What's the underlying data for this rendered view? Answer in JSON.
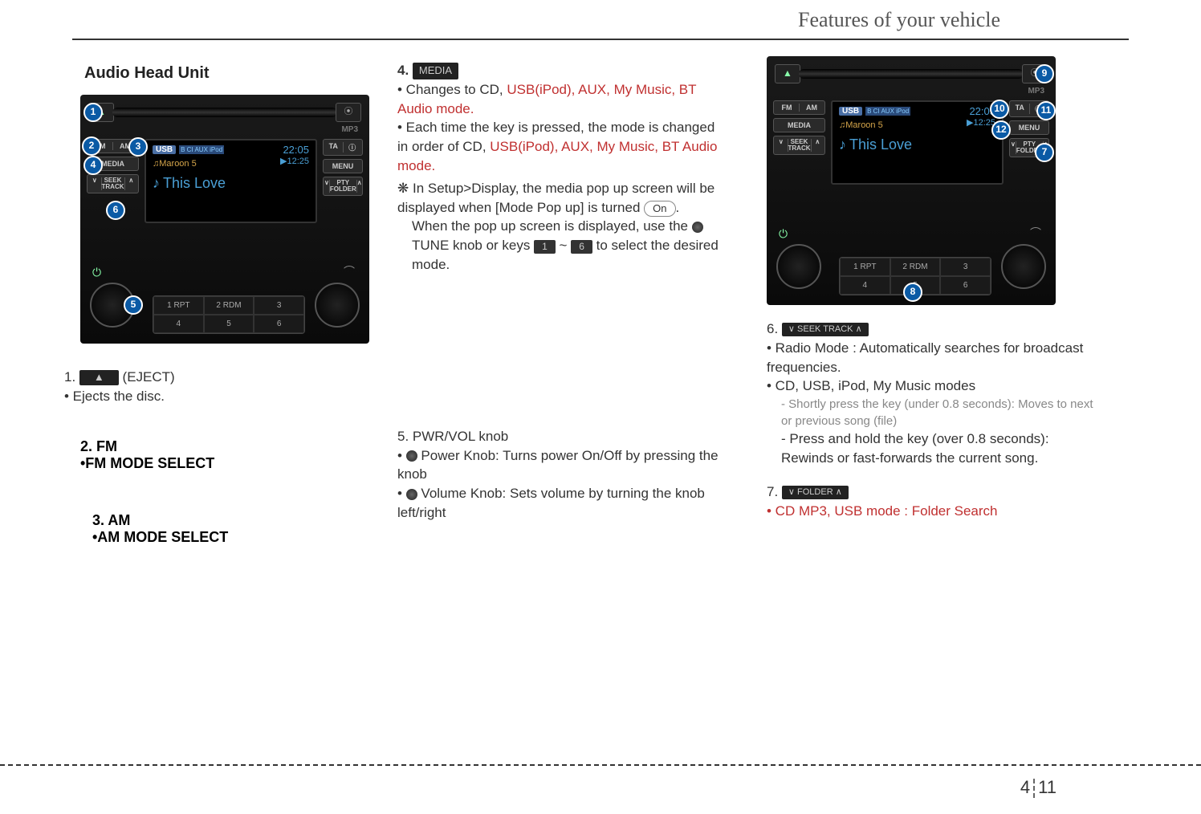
{
  "header": {
    "title": "Features of your vehicle"
  },
  "page": {
    "section": "4",
    "num": "11"
  },
  "heading": "Audio Head Unit",
  "display": {
    "source": "USB",
    "mode_icons": "B CI AUX iPod",
    "clock": "22:05",
    "artist_prefix": "♫",
    "artist": "Maroon 5",
    "play_time": "▶12:25",
    "song_prefix": "♪",
    "song": "This Love",
    "mp3": "MP3"
  },
  "buttons": {
    "eject": "▲",
    "cd": "⦿",
    "fm": "FM",
    "am": "AM",
    "media": "MEDIA",
    "seek_track_down": "∨",
    "seek_track": "SEEK\nTRACK",
    "seek_track_up": "∧",
    "ta": "TA",
    "info": "ⓘ",
    "menu": "MENU",
    "pty_folder_down": "∨",
    "pty_folder": "PTY\nFOLDER",
    "pty_folder_up": "∧",
    "power": "⏻",
    "arc": "⌒"
  },
  "presets": [
    "1 RPT",
    "2 RDM",
    "3",
    "4",
    "5",
    "6"
  ],
  "callouts": {
    "left": [
      "1",
      "2",
      "3",
      "4",
      "5",
      "6"
    ],
    "right": [
      "7",
      "8",
      "9",
      "10",
      "11",
      "12"
    ]
  },
  "item1": {
    "num": "1.",
    "btn": "▲",
    "label": "(EJECT)",
    "bullet": "• Ejects the disc."
  },
  "item2": {
    "num": "2. FM",
    "bullet": "•FM MODE SELECT"
  },
  "item3": {
    "num": "3. AM",
    "bullet": "•AM MODE SELECT"
  },
  "item4": {
    "num": "4.",
    "btn": "MEDIA",
    "b1a": "• Changes to CD,",
    "b1b": "USB(iPod), AUX, My Music, BT Audio mode.",
    "b2a": "• Each time the key is pressed, the mode is changed in order of CD,",
    "b2b": "USB(iPod), AUX, My Music, BT Audio mode.",
    "b3a": "❋ In Setup>Display, the media pop up screen will be displayed when [Mode Pop up] is turned",
    "b3on": "On",
    "b3b": ".",
    "b4a": "When the pop up screen is displayed, use the",
    "b4tune": "TUNE  knob or keys",
    "b4k1": "1",
    "b4dash": "~",
    "b4k6": "6",
    "b4end": "to select the desired mode."
  },
  "item5": {
    "num": "5. PWR/VOL knob",
    "b1": "Power Knob: Turns power On/Off by pressing the knob",
    "b2": "Volume Knob: Sets volume by turning the knob left/right"
  },
  "item6": {
    "num": "6.",
    "btn": "∨ SEEK TRACK ∧",
    "b1": "• Radio Mode : Automatically searches for broadcast frequencies.",
    "b2": "• CD, USB, iPod, My Music modes",
    "b2a": "- Shortly press the key (under 0.8 seconds): Moves to next or previous song (file)",
    "b2b": "- Press and hold the key (over 0.8 seconds): Rewinds or fast-forwards the current song."
  },
  "item7": {
    "num": "7.",
    "btn": "∨ FOLDER ∧",
    "b1": "• CD MP3, USB mode : Folder Search"
  }
}
